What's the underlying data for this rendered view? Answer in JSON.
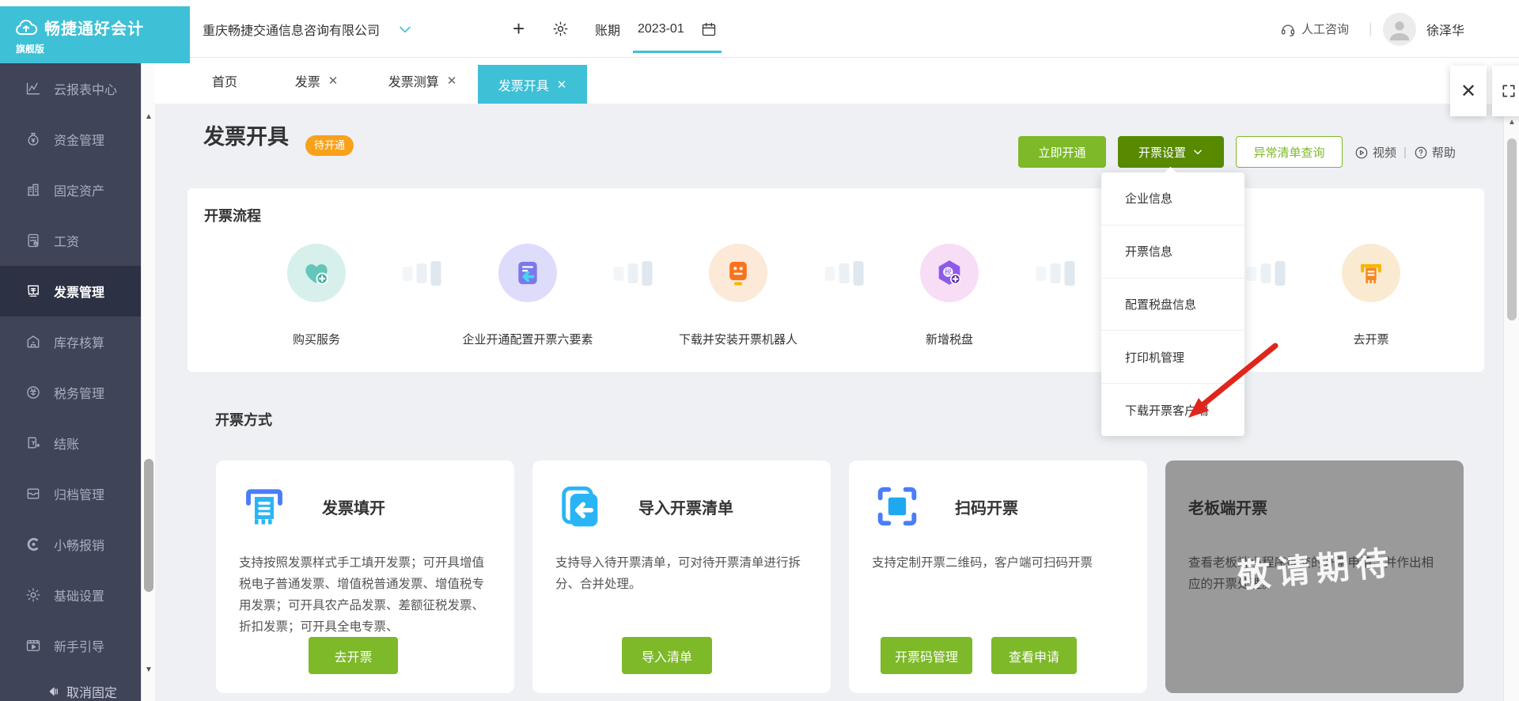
{
  "brand": {
    "logo_text": "畅捷通好会计",
    "edition": "旗舰版"
  },
  "header": {
    "company": "重庆畅捷交通信息咨询有限公司",
    "period_label": "账期",
    "period_value": "2023-01",
    "support_label": "人工咨询",
    "divider": "|",
    "username": "徐泽华"
  },
  "sidebar": {
    "items": [
      {
        "label": "云报表中心",
        "icon": "chart-line-icon",
        "active": false
      },
      {
        "label": "资金管理",
        "icon": "money-bag-icon",
        "active": false
      },
      {
        "label": "固定资产",
        "icon": "building-icon",
        "active": false
      },
      {
        "label": "工资",
        "icon": "salary-calculator-icon",
        "active": false
      },
      {
        "label": "发票管理",
        "icon": "invoice-icon",
        "active": true
      },
      {
        "label": "库存核算",
        "icon": "warehouse-icon",
        "active": false
      },
      {
        "label": "税务管理",
        "icon": "tax-circle-icon",
        "active": false
      },
      {
        "label": "结账",
        "icon": "closing-books-icon",
        "active": false
      },
      {
        "label": "归档管理",
        "icon": "archive-tray-icon",
        "active": false
      },
      {
        "label": "小畅报销",
        "icon": "expense-c-icon",
        "active": false
      },
      {
        "label": "基础设置",
        "icon": "settings-gear-icon",
        "active": false
      },
      {
        "label": "新手引导",
        "icon": "guide-video-icon",
        "active": false
      }
    ],
    "unpin_label": "取消固定"
  },
  "tabs": {
    "items": [
      {
        "label": "首页",
        "closable": false,
        "active": false
      },
      {
        "label": "发票",
        "closable": true,
        "active": false
      },
      {
        "label": "发票测算",
        "closable": true,
        "active": false
      },
      {
        "label": "发票开具",
        "closable": true,
        "active": true
      }
    ]
  },
  "page": {
    "title": "发票开具",
    "badge": "待开通"
  },
  "toolbar": {
    "activate": "立即开通",
    "settings": "开票设置",
    "abnormal_query": "异常清单查询",
    "video": "视频",
    "help": "帮助"
  },
  "settings_menu": {
    "items": [
      "企业信息",
      "开票信息",
      "配置税盘信息",
      "打印机管理",
      "下载开票客户端"
    ]
  },
  "flow": {
    "title": "开票流程",
    "steps": [
      {
        "label": "购买服务",
        "icon": "heart-plus-icon"
      },
      {
        "label": "企业开通配置开票六要素",
        "icon": "document-arrow-icon"
      },
      {
        "label": "下载并安装开票机器人",
        "icon": "robot-icon"
      },
      {
        "label": "新增税盘",
        "icon": "tax-disk-plus-icon"
      },
      {
        "label": "去开票",
        "icon": "invoice-printer-icon"
      }
    ]
  },
  "methods": {
    "title": "开票方式",
    "cards": [
      {
        "title": "发票填开",
        "icon": "invoice-print-icon",
        "desc": "支持按照发票样式手工填开发票；可开具增值税电子普通发票、增值税普通发票、增值税专用发票；可开具农产品发票、差额征税发票、折扣发票；可开具全电专票、",
        "button": "去开票"
      },
      {
        "title": "导入开票清单",
        "icon": "import-list-icon",
        "desc": "支持导入待开票清单，可对待开票清单进行拆分、合并处理。",
        "button": "导入清单"
      },
      {
        "title": "扫码开票",
        "icon": "qr-scan-icon",
        "desc": "支持定制开票二维码，客户端可扫码开票",
        "button1": "开票码管理",
        "button2": "查看申请"
      },
      {
        "title": "老板端开票",
        "icon": "none",
        "desc": "查看老板端小程序提交的开票申请，并作出相应的开票处理。",
        "watermark": "敬请期待",
        "disabled": true
      }
    ]
  },
  "colors": {
    "brand_cyan": "#3ec0d6",
    "green": "#7db928",
    "dark_green": "#588a00",
    "badge_orange": "#f9a11b",
    "arrow_red": "#e0251b",
    "sidebar_bg": "#3f4459"
  }
}
